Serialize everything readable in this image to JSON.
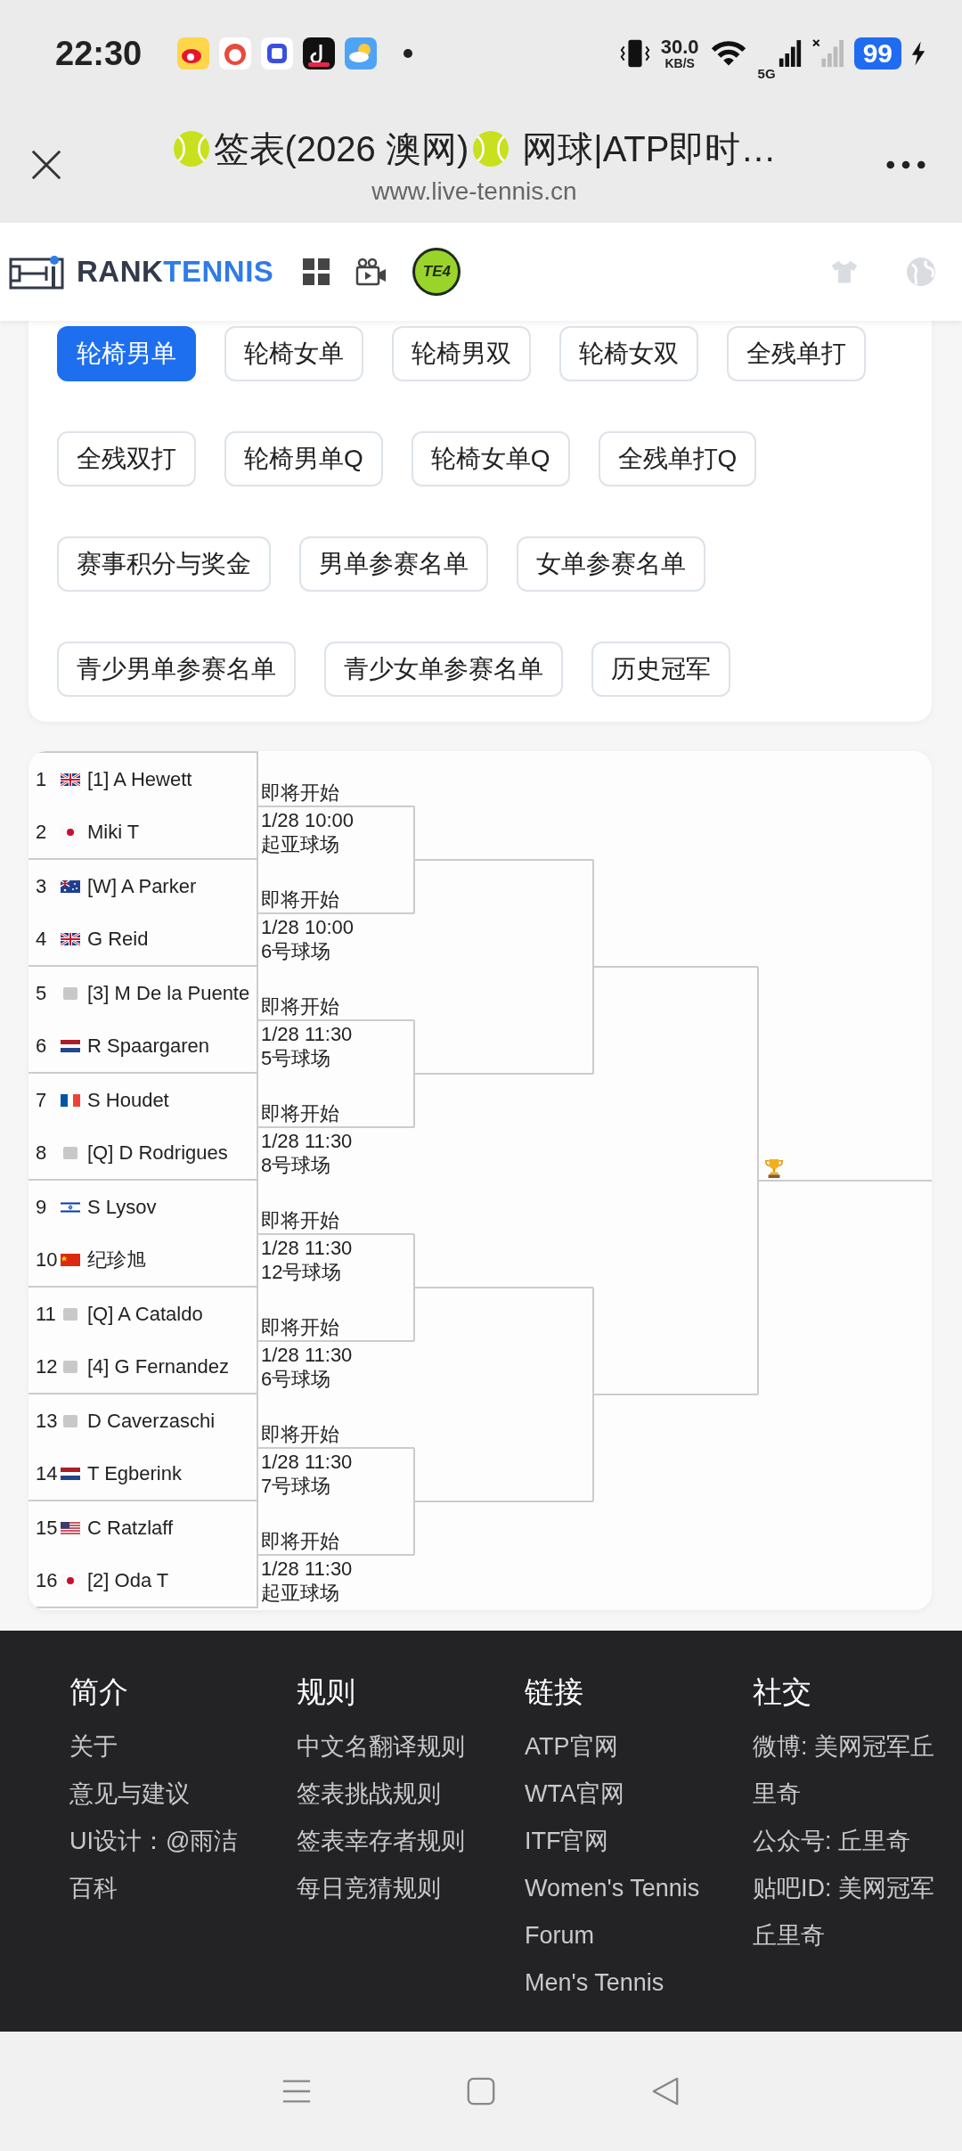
{
  "status_bar": {
    "time": "22:30",
    "net_speed_value": "30.0",
    "net_speed_unit": "KB/S",
    "network": "5G",
    "battery": "99"
  },
  "browser": {
    "title_parts": [
      "签表(2026 澳网)",
      "网球|ATP即时…"
    ],
    "url": "www.live-tennis.cn"
  },
  "site_nav": {
    "brand_dark": "RANK",
    "brand_accent": "TENNIS",
    "badge": "TE4"
  },
  "chip_rows": [
    [
      {
        "label": "轮椅男单",
        "selected": true
      },
      {
        "label": "轮椅女单",
        "selected": false
      },
      {
        "label": "轮椅男双",
        "selected": false
      },
      {
        "label": "轮椅女双",
        "selected": false
      },
      {
        "label": "全残单打",
        "selected": false
      }
    ],
    [
      {
        "label": "全残双打",
        "selected": false
      },
      {
        "label": "轮椅男单Q",
        "selected": false
      },
      {
        "label": "轮椅女单Q",
        "selected": false
      },
      {
        "label": "全残单打Q",
        "selected": false
      }
    ],
    [
      {
        "label": "赛事积分与奖金",
        "selected": false
      },
      {
        "label": "男单参赛名单",
        "selected": false
      },
      {
        "label": "女单参赛名单",
        "selected": false
      }
    ],
    [
      {
        "label": "青少男单参赛名单",
        "selected": false
      },
      {
        "label": "青少女单参赛名单",
        "selected": false
      },
      {
        "label": "历史冠军",
        "selected": false
      }
    ]
  ],
  "bracket": {
    "players": [
      {
        "number": "1",
        "kind": "gb",
        "name": "[1] A Hewett"
      },
      {
        "number": "2",
        "kind": "jp",
        "name": "Miki T"
      },
      {
        "number": "3",
        "kind": "au",
        "name": "[W] A Parker"
      },
      {
        "number": "4",
        "kind": "gb",
        "name": "G Reid"
      },
      {
        "number": "5",
        "kind": "none",
        "name": "[3] M De la Puente"
      },
      {
        "number": "6",
        "kind": "nl",
        "name": "R Spaargaren"
      },
      {
        "number": "7",
        "kind": "fr",
        "name": "S Houdet"
      },
      {
        "number": "8",
        "kind": "none",
        "name": "[Q] D Rodrigues"
      },
      {
        "number": "9",
        "kind": "il",
        "name": "S Lysov"
      },
      {
        "number": "10",
        "kind": "cn",
        "name": "纪珍旭"
      },
      {
        "number": "11",
        "kind": "none",
        "name": "[Q] A Cataldo"
      },
      {
        "number": "12",
        "kind": "none",
        "name": "[4] G Fernandez"
      },
      {
        "number": "13",
        "kind": "none",
        "name": "D Caverzaschi"
      },
      {
        "number": "14",
        "kind": "nl",
        "name": "T Egberink"
      },
      {
        "number": "15",
        "kind": "us",
        "name": "C Ratzlaff"
      },
      {
        "number": "16",
        "kind": "jp",
        "name": "[2] Oda T"
      }
    ],
    "matches": [
      {
        "status": "即将开始",
        "time": "1/28 10:00",
        "court": "起亚球场"
      },
      {
        "status": "即将开始",
        "time": "1/28 10:00",
        "court": "6号球场"
      },
      {
        "status": "即将开始",
        "time": "1/28 11:30",
        "court": "5号球场"
      },
      {
        "status": "即将开始",
        "time": "1/28 11:30",
        "court": "8号球场"
      },
      {
        "status": "即将开始",
        "time": "1/28 11:30",
        "court": "12号球场"
      },
      {
        "status": "即将开始",
        "time": "1/28 11:30",
        "court": "6号球场"
      },
      {
        "status": "即将开始",
        "time": "1/28 11:30",
        "court": "7号球场"
      },
      {
        "status": "即将开始",
        "time": "1/28 11:30",
        "court": "起亚球场"
      }
    ]
  },
  "footer": {
    "columns": [
      {
        "heading": "简介",
        "links": [
          "关于",
          "意见与建议",
          "UI设计：@雨洁百科"
        ]
      },
      {
        "heading": "规则",
        "links": [
          "中文名翻译规则",
          "签表挑战规则",
          "签表幸存者规则",
          "每日竞猜规则"
        ]
      },
      {
        "heading": "链接",
        "links": [
          "ATP官网",
          "WTA官网",
          "ITF官网",
          "Women's Tennis Forum",
          "Men's Tennis"
        ]
      },
      {
        "heading": "社交",
        "links": [
          "微博: 美网冠军丘里奇",
          "公众号: 丘里奇",
          "贴吧ID: 美网冠军丘里奇"
        ]
      }
    ]
  }
}
